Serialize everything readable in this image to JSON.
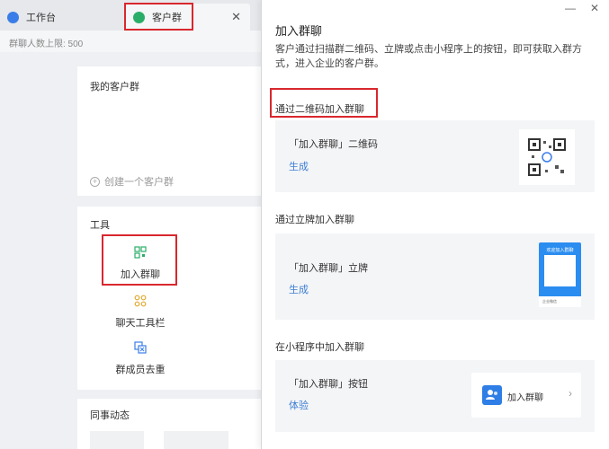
{
  "tabs": [
    {
      "label": "工作台",
      "icon": "workbench-icon"
    },
    {
      "label": "客户群",
      "icon": "customer-group-icon"
    }
  ],
  "tab_close": "✕",
  "limit_text": "群聊人数上限: 500",
  "my_groups": {
    "title": "我的客户群",
    "create_label": "创建一个客户群"
  },
  "tools": {
    "title": "工具",
    "items": [
      {
        "label": "加入群聊",
        "icon": "qr-join-icon"
      },
      {
        "label": "聊天工具栏",
        "icon": "toolbar-icon"
      },
      {
        "label": "群成员去重",
        "icon": "dedupe-icon"
      }
    ]
  },
  "feed": {
    "title": "同事动态"
  },
  "panel": {
    "controls": {
      "minimize": "—",
      "close": "✕"
    },
    "title": "加入群聊",
    "description": "客户通过扫描群二维码、立牌或点击小程序上的按钮，即可获取入群方式，进入企业的客户群。",
    "sections": [
      {
        "title": "通过二维码加入群聊",
        "option_name": "「加入群聊」二维码",
        "link": "生成"
      },
      {
        "title": "通过立牌加入群聊",
        "option_name": "「加入群聊」立牌",
        "link": "生成",
        "standee_text": "欢迎加入群聊",
        "standee_footer": "企业微信"
      },
      {
        "title": "在小程序中加入群聊",
        "option_name": "「加入群聊」按钮",
        "link": "体验",
        "button_label": "加入群聊"
      }
    ]
  },
  "colors": {
    "accent": "#3f7fd3",
    "highlight": "#d9272e",
    "green": "#2aae67"
  }
}
